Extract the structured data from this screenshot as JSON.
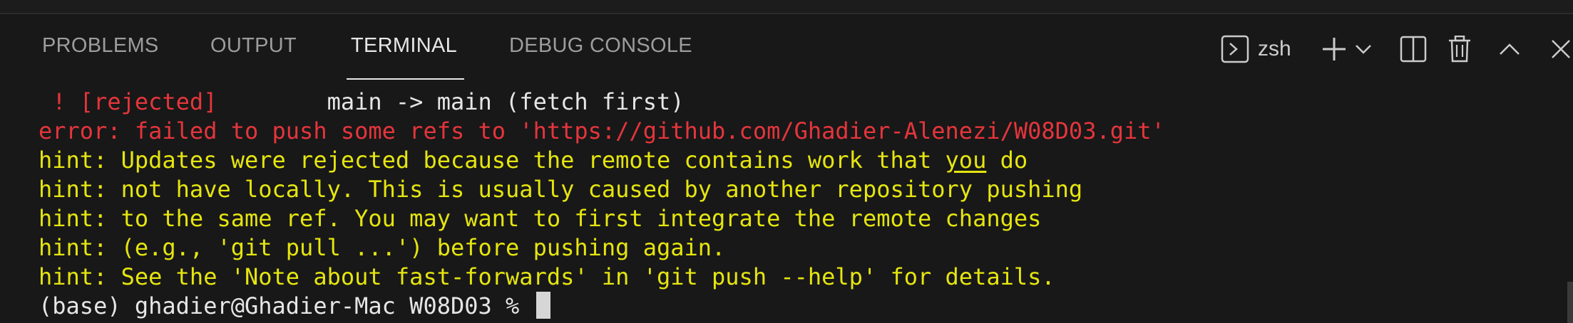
{
  "panel": {
    "tabs": [
      {
        "label": "PROBLEMS",
        "active": false
      },
      {
        "label": "OUTPUT",
        "active": false
      },
      {
        "label": "TERMINAL",
        "active": true
      },
      {
        "label": "DEBUG CONSOLE",
        "active": false
      }
    ],
    "actions": {
      "shell_name": "zsh",
      "icons": [
        "terminal-icon",
        "plus-icon",
        "chevron-down-icon",
        "split-icon",
        "trash-icon",
        "chevron-up-icon",
        "close-icon"
      ]
    }
  },
  "terminal": {
    "colors": {
      "white": "#e6e6e6",
      "error": "#e5353c",
      "hint": "#e5e510"
    },
    "lines": [
      {
        "segments": [
          {
            "text": " ! [rejected]",
            "color": "error"
          },
          {
            "text": "        main -> main (fetch first)",
            "color": "white"
          }
        ]
      },
      {
        "text": "error: failed to push some refs to 'https://github.com/Ghadier-Alenezi/W08D03.git'",
        "color": "error"
      },
      {
        "prefix": "hint: Updates were rejected because the remote contains work that ",
        "underlined": "you",
        "suffix": " do",
        "color": "hint"
      },
      {
        "text": "hint: not have locally. This is usually caused by another repository pushing",
        "color": "hint"
      },
      {
        "text": "hint: to the same ref. You may want to first integrate the remote changes",
        "color": "hint"
      },
      {
        "text": "hint: (e.g., 'git pull ...') before pushing again.",
        "color": "hint"
      },
      {
        "text": "hint: See the 'Note about fast-forwards' in 'git push --help' for details.",
        "color": "hint"
      },
      {
        "text": "(base) ghadier@Ghadier-Mac W08D03 % ",
        "color": "white"
      }
    ]
  }
}
